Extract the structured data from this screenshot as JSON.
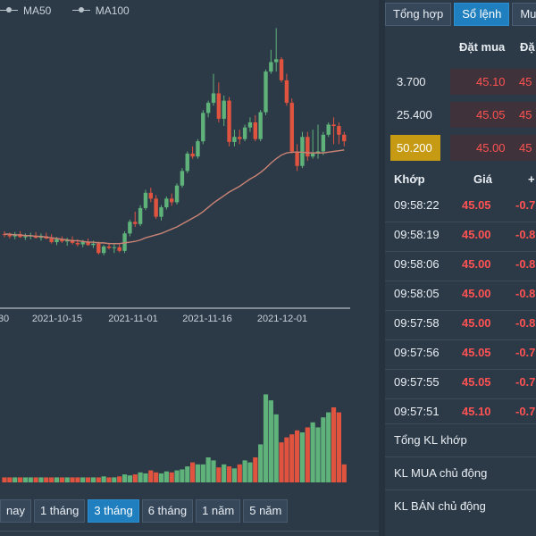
{
  "legend": {
    "ma50": "MA50",
    "ma100": "MA100"
  },
  "colors": {
    "up": "#5fb37a",
    "down": "#e0533f",
    "ma": "#c98374",
    "grid": "#3f5062",
    "axis": "#c9d2db"
  },
  "chart_data": {
    "type": "candlestick",
    "x_tick_labels": [
      "30",
      "2021-10-15",
      "2021-11-01",
      "2021-11-16",
      "2021-12-01"
    ],
    "ylim": [
      20,
      60
    ],
    "candles": [
      {
        "o": 30.2,
        "h": 30.6,
        "l": 29.8,
        "c": 30.1
      },
      {
        "o": 30.1,
        "h": 30.4,
        "l": 29.6,
        "c": 29.9
      },
      {
        "o": 29.9,
        "h": 30.5,
        "l": 29.5,
        "c": 30.2
      },
      {
        "o": 30.2,
        "h": 30.6,
        "l": 29.7,
        "c": 29.8
      },
      {
        "o": 29.8,
        "h": 30.3,
        "l": 29.4,
        "c": 29.9
      },
      {
        "o": 29.9,
        "h": 30.4,
        "l": 29.5,
        "c": 30.0
      },
      {
        "o": 30.0,
        "h": 30.5,
        "l": 29.6,
        "c": 29.7
      },
      {
        "o": 29.7,
        "h": 30.3,
        "l": 29.3,
        "c": 29.9
      },
      {
        "o": 29.9,
        "h": 30.4,
        "l": 29.5,
        "c": 29.6
      },
      {
        "o": 29.6,
        "h": 30.2,
        "l": 28.9,
        "c": 29.1
      },
      {
        "o": 29.1,
        "h": 29.8,
        "l": 28.7,
        "c": 29.5
      },
      {
        "o": 29.5,
        "h": 29.9,
        "l": 29.0,
        "c": 29.2
      },
      {
        "o": 29.2,
        "h": 29.7,
        "l": 28.6,
        "c": 29.4
      },
      {
        "o": 29.4,
        "h": 29.9,
        "l": 28.8,
        "c": 29.0
      },
      {
        "o": 29.0,
        "h": 29.5,
        "l": 28.5,
        "c": 28.8
      },
      {
        "o": 28.8,
        "h": 29.4,
        "l": 28.4,
        "c": 29.1
      },
      {
        "o": 29.1,
        "h": 29.6,
        "l": 28.6,
        "c": 28.7
      },
      {
        "o": 28.7,
        "h": 29.3,
        "l": 28.3,
        "c": 28.9
      },
      {
        "o": 28.9,
        "h": 29.2,
        "l": 27.4,
        "c": 27.6
      },
      {
        "o": 27.6,
        "h": 28.7,
        "l": 27.3,
        "c": 28.5
      },
      {
        "o": 28.5,
        "h": 29.0,
        "l": 28.1,
        "c": 28.3
      },
      {
        "o": 28.3,
        "h": 28.9,
        "l": 27.6,
        "c": 28.4
      },
      {
        "o": 28.4,
        "h": 28.8,
        "l": 27.7,
        "c": 27.9
      },
      {
        "o": 27.9,
        "h": 30.6,
        "l": 27.6,
        "c": 30.3
      },
      {
        "o": 30.3,
        "h": 32.2,
        "l": 29.9,
        "c": 31.9
      },
      {
        "o": 31.9,
        "h": 33.3,
        "l": 31.2,
        "c": 31.6
      },
      {
        "o": 31.6,
        "h": 34.2,
        "l": 31.3,
        "c": 33.8
      },
      {
        "o": 33.8,
        "h": 36.3,
        "l": 33.5,
        "c": 35.9
      },
      {
        "o": 35.9,
        "h": 36.6,
        "l": 34.6,
        "c": 35.1
      },
      {
        "o": 35.1,
        "h": 35.6,
        "l": 32.3,
        "c": 32.6
      },
      {
        "o": 32.6,
        "h": 34.2,
        "l": 32.1,
        "c": 33.9
      },
      {
        "o": 33.9,
        "h": 35.4,
        "l": 33.6,
        "c": 35.1
      },
      {
        "o": 35.1,
        "h": 35.8,
        "l": 34.1,
        "c": 34.6
      },
      {
        "o": 34.6,
        "h": 37.2,
        "l": 34.3,
        "c": 36.9
      },
      {
        "o": 36.9,
        "h": 39.3,
        "l": 36.6,
        "c": 38.9
      },
      {
        "o": 38.9,
        "h": 41.6,
        "l": 38.6,
        "c": 41.3
      },
      {
        "o": 41.3,
        "h": 42.3,
        "l": 40.6,
        "c": 40.9
      },
      {
        "o": 40.9,
        "h": 43.3,
        "l": 40.6,
        "c": 43.0
      },
      {
        "o": 43.0,
        "h": 47.3,
        "l": 42.6,
        "c": 46.9
      },
      {
        "o": 46.9,
        "h": 48.6,
        "l": 46.3,
        "c": 48.3
      },
      {
        "o": 48.3,
        "h": 52.3,
        "l": 47.9,
        "c": 49.6
      },
      {
        "o": 49.6,
        "h": 51.1,
        "l": 45.6,
        "c": 46.1
      },
      {
        "o": 46.1,
        "h": 49.3,
        "l": 45.1,
        "c": 48.6
      },
      {
        "o": 48.6,
        "h": 49.1,
        "l": 42.3,
        "c": 42.9
      },
      {
        "o": 42.9,
        "h": 44.6,
        "l": 42.3,
        "c": 43.6
      },
      {
        "o": 43.6,
        "h": 44.6,
        "l": 42.6,
        "c": 43.3
      },
      {
        "o": 43.3,
        "h": 45.3,
        "l": 43.0,
        "c": 44.9
      },
      {
        "o": 44.9,
        "h": 46.3,
        "l": 44.3,
        "c": 45.6
      },
      {
        "o": 45.6,
        "h": 46.6,
        "l": 43.0,
        "c": 43.3
      },
      {
        "o": 43.3,
        "h": 47.3,
        "l": 43.0,
        "c": 47.0
      },
      {
        "o": 47.0,
        "h": 52.9,
        "l": 46.6,
        "c": 52.6
      },
      {
        "o": 52.6,
        "h": 55.6,
        "l": 52.3,
        "c": 53.9
      },
      {
        "o": 53.9,
        "h": 58.6,
        "l": 52.6,
        "c": 54.3
      },
      {
        "o": 54.3,
        "h": 54.6,
        "l": 51.1,
        "c": 51.4
      },
      {
        "o": 51.4,
        "h": 52.3,
        "l": 47.9,
        "c": 48.3
      },
      {
        "o": 48.3,
        "h": 48.9,
        "l": 41.3,
        "c": 41.6
      },
      {
        "o": 41.6,
        "h": 42.6,
        "l": 38.9,
        "c": 39.6
      },
      {
        "o": 39.6,
        "h": 44.3,
        "l": 39.3,
        "c": 43.6
      },
      {
        "o": 43.6,
        "h": 44.3,
        "l": 40.3,
        "c": 40.9
      },
      {
        "o": 40.9,
        "h": 44.6,
        "l": 40.6,
        "c": 41.3
      },
      {
        "o": 41.3,
        "h": 45.3,
        "l": 40.6,
        "c": 41.6
      },
      {
        "o": 41.6,
        "h": 44.3,
        "l": 41.1,
        "c": 43.9
      },
      {
        "o": 43.9,
        "h": 45.6,
        "l": 43.6,
        "c": 45.3
      },
      {
        "o": 45.3,
        "h": 46.3,
        "l": 42.6,
        "c": 45.1
      },
      {
        "o": 45.1,
        "h": 45.6,
        "l": 42.6,
        "c": 43.9
      },
      {
        "o": 43.9,
        "h": 44.3,
        "l": 42.3,
        "c": 43.0
      }
    ],
    "ma": [
      30.2,
      30.2,
      30.1,
      30.1,
      30.0,
      30.0,
      29.9,
      29.9,
      29.8,
      29.7,
      29.6,
      29.5,
      29.4,
      29.3,
      29.3,
      29.2,
      29.1,
      29.1,
      29.0,
      29.0,
      28.9,
      28.9,
      28.9,
      29.0,
      29.1,
      29.2,
      29.4,
      29.7,
      29.9,
      30.1,
      30.3,
      30.6,
      30.9,
      31.2,
      31.6,
      32.0,
      32.4,
      32.8,
      33.3,
      33.9,
      34.5,
      35.0,
      35.5,
      36.0,
      36.4,
      36.8,
      37.3,
      37.8,
      38.2,
      38.7,
      39.3,
      40.0,
      40.6,
      41.1,
      41.4,
      41.5,
      41.5,
      41.5,
      41.4,
      41.4,
      41.4,
      41.4,
      41.5,
      41.6,
      41.7,
      41.8
    ],
    "volumes": [
      0.05,
      0.05,
      0.05,
      0.05,
      0.05,
      0.05,
      0.05,
      0.05,
      0.05,
      0.05,
      0.05,
      0.05,
      0.05,
      0.05,
      0.05,
      0.05,
      0.05,
      0.05,
      0.05,
      0.06,
      0.05,
      0.05,
      0.06,
      0.08,
      0.07,
      0.08,
      0.1,
      0.09,
      0.12,
      0.1,
      0.09,
      0.11,
      0.1,
      0.12,
      0.13,
      0.16,
      0.2,
      0.18,
      0.18,
      0.25,
      0.22,
      0.15,
      0.18,
      0.16,
      0.14,
      0.18,
      0.22,
      0.2,
      0.25,
      0.38,
      0.88,
      0.82,
      0.68,
      0.4,
      0.45,
      0.48,
      0.52,
      0.5,
      0.55,
      0.6,
      0.55,
      0.65,
      0.7,
      0.75,
      0.7,
      0.18
    ]
  },
  "range_buttons": [
    "nay",
    "1 tháng",
    "3 tháng",
    "6 tháng",
    "1 năm",
    "5 năm"
  ],
  "tabs": [
    "Tổng hợp",
    "Sổ lệnh",
    "Mu"
  ],
  "bid_headers": {
    "bid": "Đặt mua",
    "ask": "Đặ"
  },
  "bids": [
    {
      "vol": "3.700",
      "price": "45.10",
      "price2": "45"
    },
    {
      "vol": "25.400",
      "price": "45.05",
      "price2": "45"
    },
    {
      "vol": "50.200",
      "price": "45.00",
      "price2": "45"
    }
  ],
  "trade_headers": {
    "time": "Khớp",
    "price": "Giá",
    "change": "+"
  },
  "trades": [
    {
      "time": "09:58:22",
      "price": "45.05",
      "change": "-0.7"
    },
    {
      "time": "09:58:19",
      "price": "45.00",
      "change": "-0.8"
    },
    {
      "time": "09:58:06",
      "price": "45.00",
      "change": "-0.8"
    },
    {
      "time": "09:58:05",
      "price": "45.00",
      "change": "-0.8"
    },
    {
      "time": "09:57:58",
      "price": "45.00",
      "change": "-0.8"
    },
    {
      "time": "09:57:56",
      "price": "45.05",
      "change": "-0.7"
    },
    {
      "time": "09:57:55",
      "price": "45.05",
      "change": "-0.7"
    },
    {
      "time": "09:57:51",
      "price": "45.10",
      "change": "-0.7"
    }
  ],
  "summary": [
    "Tổng KL khớp",
    "KL MUA chủ động",
    "KL BÁN chủ động"
  ]
}
